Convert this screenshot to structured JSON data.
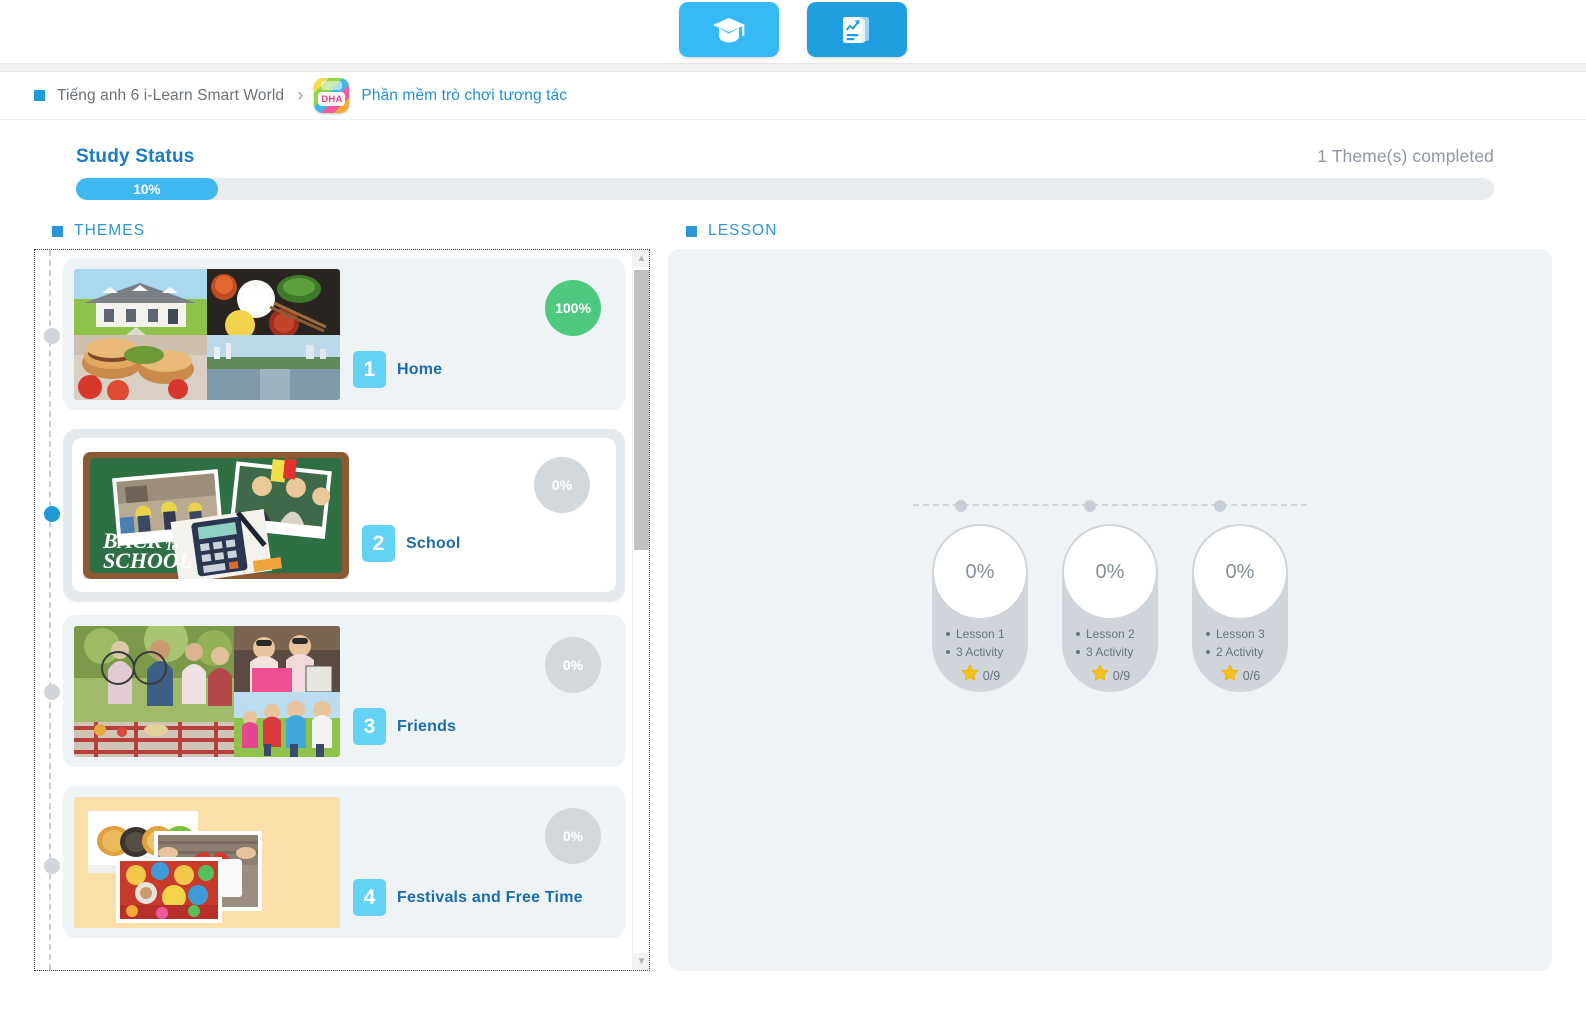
{
  "topbar": {
    "tabs": [
      {
        "name": "study-tab",
        "icon": "graduation-cap-icon",
        "color": "#35baf6"
      },
      {
        "name": "report-tab",
        "icon": "report-chart-icon",
        "color": "#1f9fe0"
      }
    ]
  },
  "breadcrumb": {
    "root": "Tiếng anh 6 i-Learn Smart World",
    "separator": "›",
    "app_icon_label": "DHA",
    "current": "Phần mềm trò chơi tương tác"
  },
  "study_status": {
    "title": "Study Status",
    "completed_text": "1 Theme(s) completed",
    "progress_label": "10%",
    "progress_percent": 10
  },
  "sections": {
    "themes_label": "THEMES",
    "lesson_label": "LESSON"
  },
  "themes": [
    {
      "number": "1",
      "title": "Home",
      "percent": "100%",
      "state": "completed"
    },
    {
      "number": "2",
      "title": "School",
      "percent": "0%",
      "state": "selected"
    },
    {
      "number": "3",
      "title": "Friends",
      "percent": "0%",
      "state": "default"
    },
    {
      "number": "4",
      "title": "Festivals and Free Time",
      "percent": "0%",
      "state": "default"
    }
  ],
  "lessons": [
    {
      "percent": "0%",
      "name": "Lesson 1",
      "activities": "3 Activity",
      "stars": "0/9"
    },
    {
      "percent": "0%",
      "name": "Lesson 2",
      "activities": "3 Activity",
      "stars": "0/9"
    },
    {
      "percent": "0%",
      "name": "Lesson 3",
      "activities": "2 Activity",
      "stars": "0/6"
    }
  ],
  "colors": {
    "accent_blue": "#1e9ad6",
    "progress_blue": "#3fb8ef",
    "complete_green": "#4ec97f",
    "zero_gray": "#d3d8dc",
    "star_gold": "#f5c518"
  }
}
